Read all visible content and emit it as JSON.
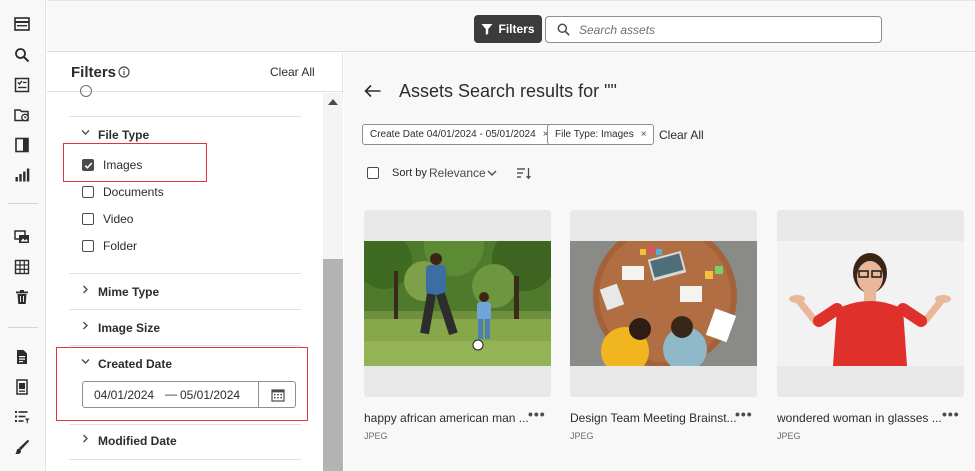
{
  "rail": {
    "icons": [
      "card-view-icon",
      "search-icon",
      "checklist-icon",
      "folder-clock-icon",
      "collection-icon",
      "insights-icon",
      "images-icon",
      "grid-icon",
      "trash-icon",
      "document-icon",
      "file-stack-icon",
      "list-filter-icon",
      "brush-icon"
    ]
  },
  "topbar": {
    "filters_label": "Filters",
    "search_placeholder": "Search assets"
  },
  "filters": {
    "title": "Filters",
    "clear_all": "Clear All",
    "file_type": {
      "title": "File Type",
      "options": [
        {
          "label": "Images",
          "checked": true
        },
        {
          "label": "Documents",
          "checked": false
        },
        {
          "label": "Video",
          "checked": false
        },
        {
          "label": "Folder",
          "checked": false
        }
      ]
    },
    "mime_type": {
      "title": "Mime Type"
    },
    "image_size": {
      "title": "Image Size"
    },
    "created_date": {
      "title": "Created Date",
      "start": "04/01/2024",
      "separator": "—",
      "end": "05/01/2024"
    },
    "modified_date": {
      "title": "Modified Date"
    }
  },
  "results": {
    "title": "Assets Search results for \"\"",
    "chips": [
      {
        "label": "Create Date 04/01/2024 - 05/01/2024",
        "remove": "×"
      },
      {
        "label": "File Type: Images",
        "remove": "×"
      }
    ],
    "clear_all": "Clear All",
    "sort_by_label": "Sort by",
    "sort_value": "Relevance",
    "assets": [
      {
        "name": "happy african american man ...",
        "type": "JPEG",
        "more": "•••"
      },
      {
        "name": "Design Team Meeting Brainst...",
        "type": "JPEG",
        "more": "•••"
      },
      {
        "name": "wondered woman in glasses ...",
        "type": "JPEG",
        "more": "•••"
      }
    ]
  },
  "colors": {
    "accent_dark": "#3b3b3b",
    "annotation_red": "#e0343b",
    "background": "#f8f8f8"
  }
}
